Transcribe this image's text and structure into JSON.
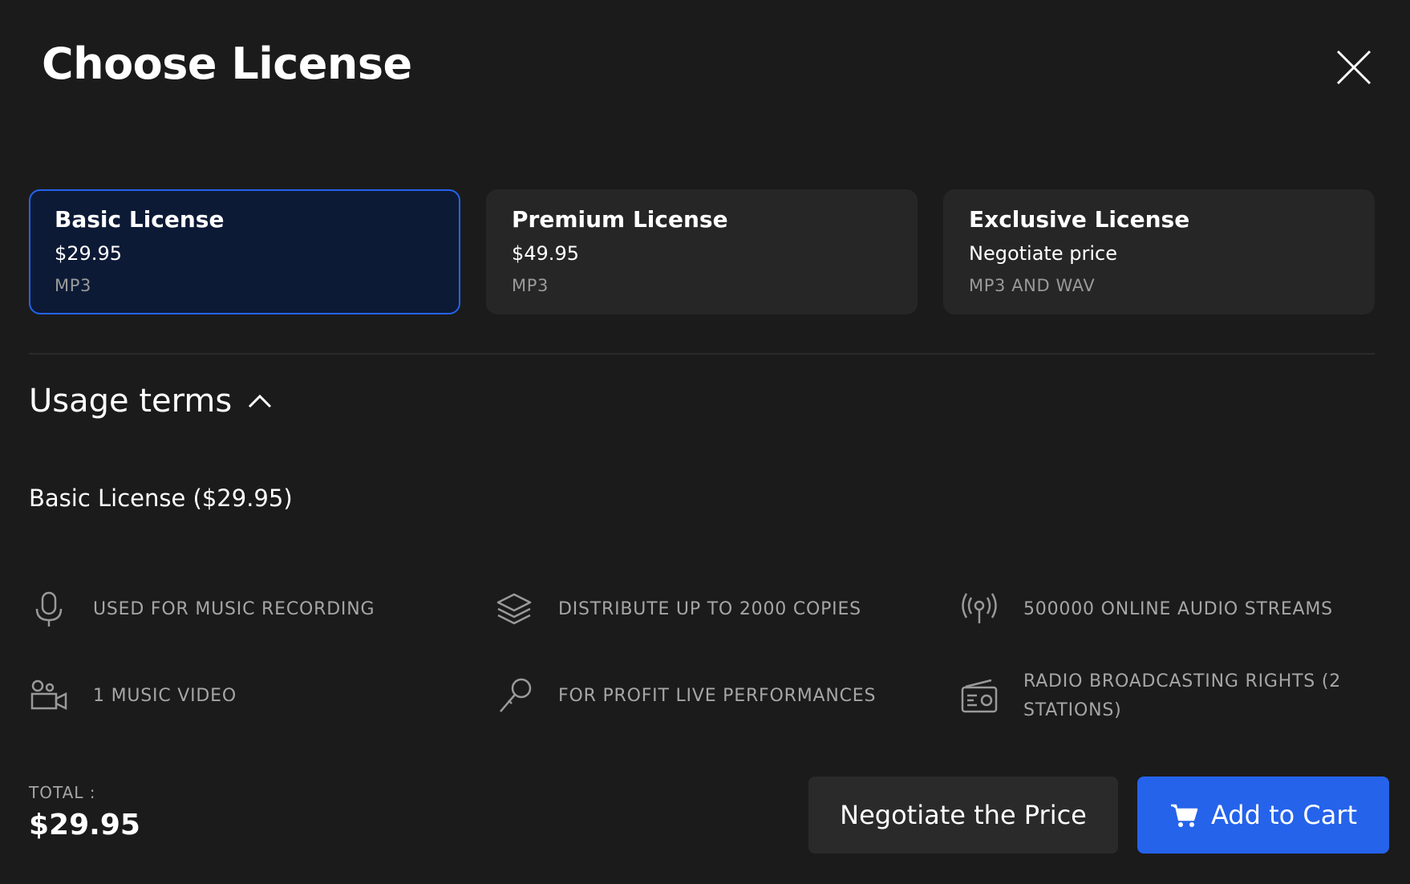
{
  "header": {
    "title": "Choose License"
  },
  "licenses": [
    {
      "name": "Basic License",
      "price": "$29.95",
      "format": "MP3"
    },
    {
      "name": "Premium License",
      "price": "$49.95",
      "format": "MP3"
    },
    {
      "name": "Exclusive License",
      "price": "Negotiate price",
      "format": "MP3 AND WAV"
    }
  ],
  "usage": {
    "title": "Usage terms",
    "summary": "Basic License ($29.95)",
    "terms": [
      {
        "icon": "microphone-icon",
        "text": "USED FOR MUSIC RECORDING"
      },
      {
        "icon": "layers-icon",
        "text": "DISTRIBUTE UP TO 2000 COPIES"
      },
      {
        "icon": "broadcast-icon",
        "text": "500000 ONLINE AUDIO STREAMS"
      },
      {
        "icon": "video-camera-icon",
        "text": "1 MUSIC VIDEO"
      },
      {
        "icon": "handheld-mic-icon",
        "text": "FOR PROFIT LIVE PERFORMANCES"
      },
      {
        "icon": "radio-icon",
        "text": "RADIO BROADCASTING RIGHTS (2 STATIONS)"
      }
    ]
  },
  "footer": {
    "total_label": "TOTAL :",
    "total_value": "$29.95",
    "negotiate_label": "Negotiate the Price",
    "cart_label": "Add to Cart"
  },
  "colors": {
    "accent": "#2563eb",
    "background": "#1b1b1b",
    "card": "#262626",
    "selected_card": "#0d1a36"
  }
}
